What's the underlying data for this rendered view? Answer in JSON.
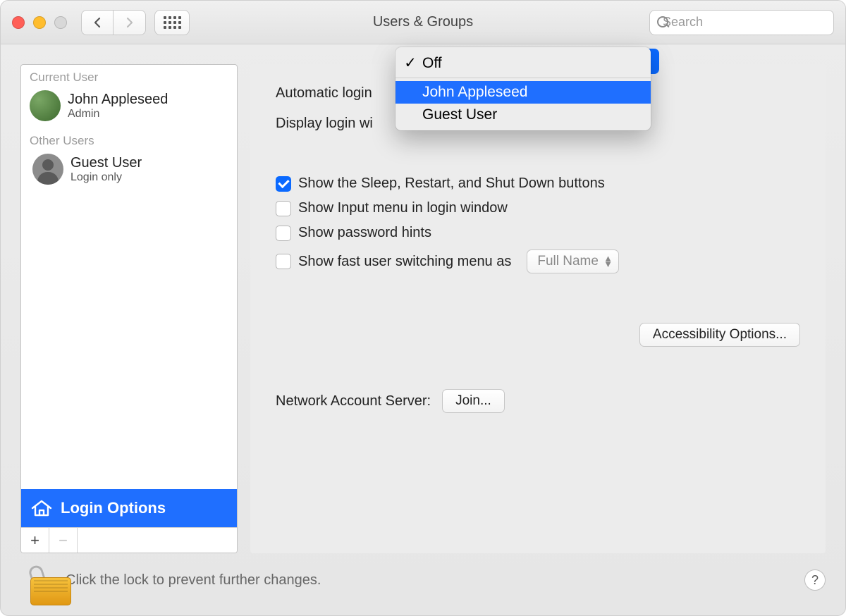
{
  "window": {
    "title": "Users & Groups"
  },
  "search": {
    "placeholder": "Search"
  },
  "sidebar": {
    "sections": {
      "current_label": "Current User",
      "other_label": "Other Users"
    },
    "current": {
      "name": "John Appleseed",
      "role": "Admin"
    },
    "other": {
      "name": "Guest User",
      "role": "Login only"
    },
    "login_options_label": "Login Options"
  },
  "main": {
    "auto_login_label": "Automatic login",
    "display_login_label": "Display login wi",
    "checkbox_sleep": "Show the Sleep, Restart, and Shut Down buttons",
    "checkbox_input_menu": "Show Input menu in login window",
    "checkbox_pw_hints": "Show password hints",
    "checkbox_fast_switch": "Show fast user switching menu as",
    "fast_switch_value": "Full Name",
    "accessibility_button": "Accessibility Options...",
    "network_label": "Network Account Server:",
    "join_button": "Join..."
  },
  "dropdown": {
    "off": "Off",
    "user1": "John Appleseed",
    "user2": "Guest User"
  },
  "footer": {
    "lock_message": "Click the lock to prevent further changes.",
    "help": "?"
  }
}
